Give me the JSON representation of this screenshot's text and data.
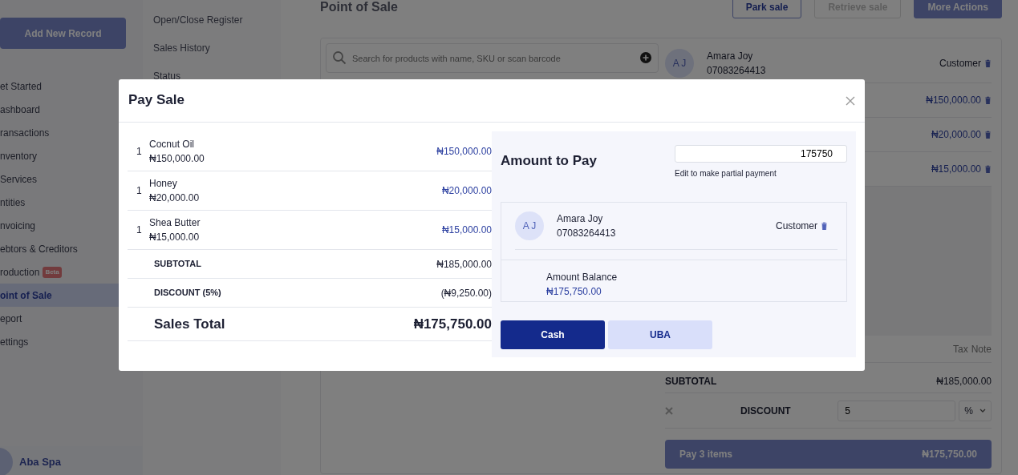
{
  "sidebar": {
    "add_button": "Add New Record",
    "items": [
      {
        "label": "et Started",
        "selected": false
      },
      {
        "label": "ashboard",
        "selected": false
      },
      {
        "label": "ransactions",
        "selected": false
      },
      {
        "label": "nventory",
        "selected": false
      },
      {
        "label": "Services",
        "selected": false
      },
      {
        "label": "ntities",
        "selected": false
      },
      {
        "label": "nvoicing",
        "selected": false
      },
      {
        "label": "ebtors & Creditors",
        "selected": false
      },
      {
        "label": "roduction",
        "selected": false,
        "badge": "Beta"
      },
      {
        "label": "oint of Sale",
        "selected": true
      },
      {
        "label": "eport",
        "selected": false
      },
      {
        "label": "ettings",
        "selected": false
      }
    ],
    "business": "Aba Spa"
  },
  "submenu": [
    "Open/Close Register",
    "Sales History",
    "Status"
  ],
  "header": {
    "title": "Point of Sale",
    "buttons": [
      {
        "label": "Park sale",
        "kind": "outline",
        "disabled": false
      },
      {
        "label": "Retrieve sale",
        "kind": "outline",
        "disabled": true
      },
      {
        "label": "More Actions",
        "kind": "solid",
        "disabled": false
      }
    ]
  },
  "search": {
    "placeholder": "Search for products with name, SKU or scan barcode"
  },
  "cart": {
    "customer": {
      "initials": "A J",
      "name": "Amara Joy",
      "phone": "07083264413",
      "role": "Customer"
    },
    "line_prices": [
      "₦150,000.00",
      "₦20,000.00",
      "₦15,000.00"
    ],
    "columns": [
      "Tax",
      "Note"
    ],
    "subtotal": {
      "label": "SUBTOTAL",
      "value": "₦185,000.00"
    },
    "discount": {
      "label": "DISCOUNT",
      "value": "5",
      "unit": "%"
    },
    "pay_button": {
      "label": "Pay 3 items",
      "amount": "₦175,750.00"
    }
  },
  "modal": {
    "title": "Pay Sale",
    "items": [
      {
        "qty": "1",
        "name": "Cocnut Oil",
        "unit_price": "₦150,000.00",
        "total": "₦150,000.00"
      },
      {
        "qty": "1",
        "name": "Honey",
        "unit_price": "₦20,000.00",
        "total": "₦20,000.00"
      },
      {
        "qty": "1",
        "name": "Shea Butter",
        "unit_price": "₦15,000.00",
        "total": "₦15,000.00"
      }
    ],
    "subtotal": {
      "label": "SUBTOTAL",
      "value": "₦185,000.00"
    },
    "discount": {
      "label": "DISCOUNT (5%)",
      "value": "(₦9,250.00)"
    },
    "total": {
      "label": "Sales Total",
      "value": "₦175,750.00"
    },
    "amount_to_pay": {
      "label": "Amount to Pay",
      "value": "175750",
      "hint": "Edit to make partial payment"
    },
    "customer": {
      "initials": "A J",
      "name": "Amara Joy",
      "phone": "07083264413",
      "role": "Customer"
    },
    "balance": {
      "label": "Amount Balance",
      "value": "₦175,750.00"
    },
    "payment_methods": [
      {
        "label": "Cash",
        "selected": true
      },
      {
        "label": "UBA",
        "selected": false
      }
    ]
  }
}
